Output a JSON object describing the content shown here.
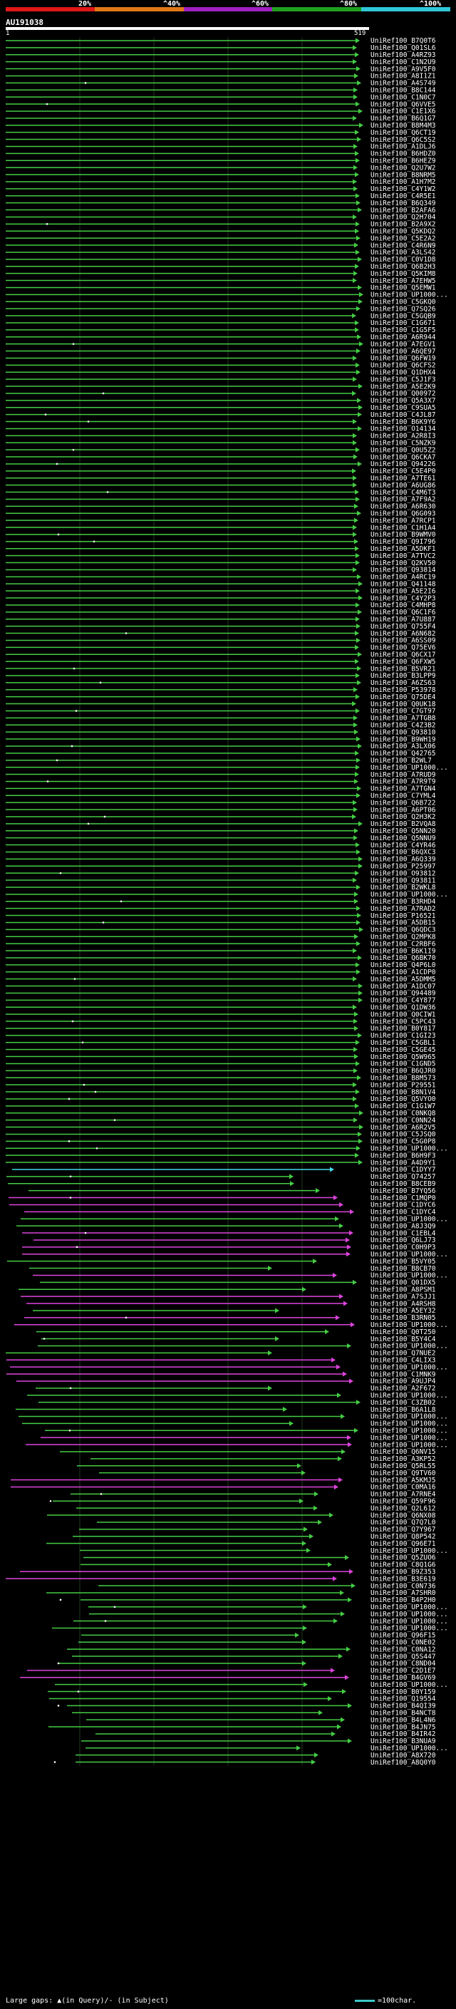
{
  "header": {
    "percent_labels": [
      "20%",
      "^40%",
      "^60%",
      "^80%",
      "^100%"
    ],
    "segment_colors": [
      "#e01818",
      "#e07818",
      "#a020c0",
      "#20a020",
      "#30c8d8"
    ]
  },
  "query": {
    "title": "AU191038",
    "start": "1",
    "end": "519"
  },
  "colors": {
    "green": "#44cc44",
    "magenta": "#dd44dd",
    "cyan": "#44d8e8",
    "grid": "#1e3a1e"
  },
  "hits": [
    {
      "acc": "UniRef100_B7Q0T6",
      "color": "green"
    },
    {
      "acc": "UniRef100_Q01SL6",
      "color": "green"
    },
    {
      "acc": "UniRef100_A4RZ93",
      "color": "green"
    },
    {
      "acc": "UniRef100_C1N2U9",
      "color": "green"
    },
    {
      "acc": "UniRef100_A9V5F0",
      "color": "green"
    },
    {
      "acc": "UniRef100_A8I1Z1",
      "color": "green"
    },
    {
      "acc": "UniRef100_A4S749",
      "color": "green"
    },
    {
      "acc": "UniRef100_B8C144",
      "color": "green"
    },
    {
      "acc": "UniRef100_C1N0C7",
      "color": "green"
    },
    {
      "acc": "UniRef100_Q6VVE5",
      "color": "green"
    },
    {
      "acc": "UniRef100_C1E1X6",
      "color": "green"
    },
    {
      "acc": "UniRef100_B6Q1G7",
      "color": "green"
    },
    {
      "acc": "UniRef100_B8M4M3",
      "color": "green"
    },
    {
      "acc": "UniRef100_Q6CT19",
      "color": "green"
    },
    {
      "acc": "UniRef100_Q6C5S2",
      "color": "green"
    },
    {
      "acc": "UniRef100_A1DLJ6",
      "color": "green"
    },
    {
      "acc": "UniRef100_B6HDZ0",
      "color": "green"
    },
    {
      "acc": "UniRef100_B6HEZ9",
      "color": "green"
    },
    {
      "acc": "UniRef100_Q2U7W2",
      "color": "green"
    },
    {
      "acc": "UniRef100_B8NRM5",
      "color": "green"
    },
    {
      "acc": "UniRef100_A1H7M2",
      "color": "green"
    },
    {
      "acc": "UniRef100_C4Y1W2",
      "color": "green"
    },
    {
      "acc": "UniRef100_C4R5E1",
      "color": "green"
    },
    {
      "acc": "UniRef100_B6Q349",
      "color": "green"
    },
    {
      "acc": "UniRef100_B2AFA6",
      "color": "green"
    },
    {
      "acc": "UniRef100_Q2H704",
      "color": "green"
    },
    {
      "acc": "UniRef100_B2A9X2",
      "color": "green"
    },
    {
      "acc": "UniRef100_Q5KDQ2",
      "color": "green"
    },
    {
      "acc": "UniRef100_C5E2A2",
      "color": "green"
    },
    {
      "acc": "UniRef100_C4R6N9",
      "color": "green"
    },
    {
      "acc": "UniRef100_A3LS42",
      "color": "green"
    },
    {
      "acc": "UniRef100_C0V1D8",
      "color": "green"
    },
    {
      "acc": "UniRef100_Q6B2H3",
      "color": "green"
    },
    {
      "acc": "UniRef100_Q5KIM8",
      "color": "green"
    },
    {
      "acc": "UniRef100_A7EHW5",
      "color": "green"
    },
    {
      "acc": "UniRef100_Q5EMW1",
      "color": "green"
    },
    {
      "acc": "UniRef100_UP1000...",
      "color": "green"
    },
    {
      "acc": "UniRef100_C5GKQ0",
      "color": "green"
    },
    {
      "acc": "UniRef100_Q7SQ26",
      "color": "green"
    },
    {
      "acc": "UniRef100_C5GQB9",
      "color": "green"
    },
    {
      "acc": "UniRef100_C1G671",
      "color": "green"
    },
    {
      "acc": "UniRef100_C1G5F5",
      "color": "green"
    },
    {
      "acc": "UniRef100_A6R944",
      "color": "green"
    },
    {
      "acc": "UniRef100_A7EGV1",
      "color": "green"
    },
    {
      "acc": "UniRef100_A6QE97",
      "color": "green"
    },
    {
      "acc": "UniRef100_Q6FW19",
      "color": "green"
    },
    {
      "acc": "UniRef100_Q6CFS2",
      "color": "green"
    },
    {
      "acc": "UniRef100_Q1DHX4",
      "color": "green"
    },
    {
      "acc": "UniRef100_C5J1F3",
      "color": "green"
    },
    {
      "acc": "UniRef100_A5E2K9",
      "color": "green"
    },
    {
      "acc": "UniRef100_Q00972",
      "color": "green"
    },
    {
      "acc": "UniRef100_Q5A3X7",
      "color": "green"
    },
    {
      "acc": "UniRef100_C9SUA5",
      "color": "green"
    },
    {
      "acc": "UniRef100_C4JL87",
      "color": "green"
    },
    {
      "acc": "UniRef100_B6K9Y6",
      "color": "green"
    },
    {
      "acc": "UniRef100_O14134",
      "color": "green"
    },
    {
      "acc": "UniRef100_A2R8I3",
      "color": "green"
    },
    {
      "acc": "UniRef100_C5NZK9",
      "color": "green"
    },
    {
      "acc": "UniRef100_Q0U5Z2",
      "color": "green"
    },
    {
      "acc": "UniRef100_Q6CKA7",
      "color": "green"
    },
    {
      "acc": "UniRef100_Q94226",
      "color": "green"
    },
    {
      "acc": "UniRef100_C5E4P0",
      "color": "green"
    },
    {
      "acc": "UniRef100_A7TE61",
      "color": "green"
    },
    {
      "acc": "UniRef100_A6UG86",
      "color": "green"
    },
    {
      "acc": "UniRef100_C4M6T3",
      "color": "green"
    },
    {
      "acc": "UniRef100_A7F9A2",
      "color": "green"
    },
    {
      "acc": "UniRef100_A6R630",
      "color": "green"
    },
    {
      "acc": "UniRef100_Q6G093",
      "color": "green"
    },
    {
      "acc": "UniRef100_A7RCP1",
      "color": "green"
    },
    {
      "acc": "UniRef100_C1H1A4",
      "color": "green"
    },
    {
      "acc": "UniRef100_B9WMV0",
      "color": "green"
    },
    {
      "acc": "UniRef100_Q9I796",
      "color": "green"
    },
    {
      "acc": "UniRef100_A5DKF1",
      "color": "green"
    },
    {
      "acc": "UniRef100_A7TVC2",
      "color": "green"
    },
    {
      "acc": "UniRef100_Q2KV50",
      "color": "green"
    },
    {
      "acc": "UniRef100_Q93814",
      "color": "green"
    },
    {
      "acc": "UniRef100_A4RC19",
      "color": "green"
    },
    {
      "acc": "UniRef100_Q41148",
      "color": "green"
    },
    {
      "acc": "UniRef100_A5E2I6",
      "color": "green"
    },
    {
      "acc": "UniRef100_C4Y2P3",
      "color": "green"
    },
    {
      "acc": "UniRef100_C4MHP8",
      "color": "green"
    },
    {
      "acc": "UniRef100_Q6C1F6",
      "color": "green"
    },
    {
      "acc": "UniRef100_A7U887",
      "color": "green"
    },
    {
      "acc": "UniRef100_Q755F4",
      "color": "green"
    },
    {
      "acc": "UniRef100_A6N682",
      "color": "green"
    },
    {
      "acc": "UniRef100_A6SS09",
      "color": "green"
    },
    {
      "acc": "UniRef100_Q75EV6",
      "color": "green"
    },
    {
      "acc": "UniRef100_Q6CX17",
      "color": "green"
    },
    {
      "acc": "UniRef100_Q6FXW5",
      "color": "green"
    },
    {
      "acc": "UniRef100_B5VR21",
      "color": "green"
    },
    {
      "acc": "UniRef100_B3LPP9",
      "color": "green"
    },
    {
      "acc": "UniRef100_A6ZS63",
      "color": "green"
    },
    {
      "acc": "UniRef100_P53978",
      "color": "green"
    },
    {
      "acc": "UniRef100_Q75DE4",
      "color": "green"
    },
    {
      "acc": "UniRef100_Q0UK18",
      "color": "green"
    },
    {
      "acc": "UniRef100_C7GT97",
      "color": "green"
    },
    {
      "acc": "UniRef100_A7TGB8",
      "color": "green"
    },
    {
      "acc": "UniRef100_C4Z3B2",
      "color": "green"
    },
    {
      "acc": "UniRef100_Q93810",
      "color": "green"
    },
    {
      "acc": "UniRef100_B9WH19",
      "color": "green"
    },
    {
      "acc": "UniRef100_A3LX06",
      "color": "green"
    },
    {
      "acc": "UniRef100_Q42765",
      "color": "green"
    },
    {
      "acc": "UniRef100_B2WL7",
      "color": "green"
    },
    {
      "acc": "UniRef100_UP1000...",
      "color": "green"
    },
    {
      "acc": "UniRef100_A7RUD9",
      "color": "green"
    },
    {
      "acc": "UniRef100_A7R9T9",
      "color": "green"
    },
    {
      "acc": "UniRef100_A7TGN4",
      "color": "green"
    },
    {
      "acc": "UniRef100_C7YML4",
      "color": "green"
    },
    {
      "acc": "UniRef100_Q6B722",
      "color": "green"
    },
    {
      "acc": "UniRef100_A6PT06",
      "color": "green"
    },
    {
      "acc": "UniRef100_Q2H3K2",
      "color": "green"
    },
    {
      "acc": "UniRef100_B2VQA8",
      "color": "green"
    },
    {
      "acc": "UniRef100_Q5NN20",
      "color": "green"
    },
    {
      "acc": "UniRef100_Q5NNU9",
      "color": "green"
    },
    {
      "acc": "UniRef100_C4YR46",
      "color": "green"
    },
    {
      "acc": "UniRef100_B6QXC3",
      "color": "green"
    },
    {
      "acc": "UniRef100_A6Q339",
      "color": "green"
    },
    {
      "acc": "UniRef100_P25997",
      "color": "green"
    },
    {
      "acc": "UniRef100_O93812",
      "color": "green"
    },
    {
      "acc": "UniRef100_Q93811",
      "color": "green"
    },
    {
      "acc": "UniRef100_B2WKL8",
      "color": "green"
    },
    {
      "acc": "UniRef100_UP1000...",
      "color": "green"
    },
    {
      "acc": "UniRef100_B3RHD4",
      "color": "green"
    },
    {
      "acc": "UniRef100_A7RAD2",
      "color": "green"
    },
    {
      "acc": "UniRef100_P16521",
      "color": "green"
    },
    {
      "acc": "UniRef100_A5DB15",
      "color": "green"
    },
    {
      "acc": "UniRef100_Q6QDC3",
      "color": "green"
    },
    {
      "acc": "UniRef100_Q2MPK8",
      "color": "green"
    },
    {
      "acc": "UniRef100_C2RBF6",
      "color": "green"
    },
    {
      "acc": "UniRef100_B6K1I9",
      "color": "green"
    },
    {
      "acc": "UniRef100_Q6BK70",
      "color": "green"
    },
    {
      "acc": "UniRef100_Q4P6L0",
      "color": "green"
    },
    {
      "acc": "UniRef100_A1CDP0",
      "color": "green"
    },
    {
      "acc": "UniRef100_A5DMM5",
      "color": "green"
    },
    {
      "acc": "UniRef100_A1DC07",
      "color": "green"
    },
    {
      "acc": "UniRef100_Q94489",
      "color": "green"
    },
    {
      "acc": "UniRef100_C4Y877",
      "color": "green"
    },
    {
      "acc": "UniRef100_Q1DW36",
      "color": "green"
    },
    {
      "acc": "UniRef100_Q0CIW1",
      "color": "green"
    },
    {
      "acc": "UniRef100_C5PC43",
      "color": "green"
    },
    {
      "acc": "UniRef100_B0Y817",
      "color": "green"
    },
    {
      "acc": "UniRef100_C1GI23",
      "color": "green"
    },
    {
      "acc": "UniRef100_C5GBL1",
      "color": "green"
    },
    {
      "acc": "UniRef100_C5GE45",
      "color": "green"
    },
    {
      "acc": "UniRef100_Q5W965",
      "color": "green"
    },
    {
      "acc": "UniRef100_C1GND5",
      "color": "green"
    },
    {
      "acc": "UniRef100_B6QJR0",
      "color": "green"
    },
    {
      "acc": "UniRef100_B8M573",
      "color": "green"
    },
    {
      "acc": "UniRef100_P29551",
      "color": "green"
    },
    {
      "acc": "UniRef100_B8N1V4",
      "color": "green"
    },
    {
      "acc": "UniRef100_Q5VYO0",
      "color": "green"
    },
    {
      "acc": "UniRef100_C1G1W7",
      "color": "green"
    },
    {
      "acc": "UniRef100_C0NKQ8",
      "color": "green"
    },
    {
      "acc": "UniRef100_C0NN24",
      "color": "green"
    },
    {
      "acc": "UniRef100_A6R2V5",
      "color": "green"
    },
    {
      "acc": "UniRef100_C5JSQ0",
      "color": "green"
    },
    {
      "acc": "UniRef100_C5G0P8",
      "color": "green"
    },
    {
      "acc": "UniRef100_UP1000...",
      "color": "green"
    },
    {
      "acc": "UniRef100_B6H9F3",
      "color": "green"
    },
    {
      "acc": "UniRef100_A4D9Y1",
      "color": "green"
    },
    {
      "acc": "UniRef100_C1DYY7",
      "color": "cyan"
    },
    {
      "acc": "UniRef100_Q74257",
      "color": "green"
    },
    {
      "acc": "UniRef100_B8CEB9",
      "color": "green"
    },
    {
      "acc": "UniRef100_B7YQ56",
      "color": "green"
    },
    {
      "acc": "UniRef100_C1MQP0",
      "color": "magenta"
    },
    {
      "acc": "UniRef100_C1DYC6",
      "color": "magenta"
    },
    {
      "acc": "UniRef100_C1DYC4",
      "color": "magenta"
    },
    {
      "acc": "UniRef100_UP1000...",
      "color": "green"
    },
    {
      "acc": "UniRef100_A8J3Q9",
      "color": "green"
    },
    {
      "acc": "UniRef100_C1EBL4",
      "color": "magenta"
    },
    {
      "acc": "UniRef100_Q6LJ73",
      "color": "magenta"
    },
    {
      "acc": "UniRef100_C0H9P3",
      "color": "magenta"
    },
    {
      "acc": "UniRef100_UP1000...",
      "color": "magenta"
    },
    {
      "acc": "UniRef100_B5VY05",
      "color": "green"
    },
    {
      "acc": "UniRef100_B8CB70",
      "color": "green"
    },
    {
      "acc": "UniRef100_UP1000...",
      "color": "magenta"
    },
    {
      "acc": "UniRef100_Q01DX5",
      "color": "green"
    },
    {
      "acc": "UniRef100_A8PSM1",
      "color": "green"
    },
    {
      "acc": "UniRef100_A7SJJ1",
      "color": "magenta"
    },
    {
      "acc": "UniRef100_A4RSH8",
      "color": "magenta"
    },
    {
      "acc": "UniRef100_A5EY32",
      "color": "green"
    },
    {
      "acc": "UniRef100_B3RN05",
      "color": "magenta"
    },
    {
      "acc": "UniRef100_UP1000...",
      "color": "magenta"
    },
    {
      "acc": "UniRef100_Q0T250",
      "color": "green"
    },
    {
      "acc": "UniRef100_B5Y4C4",
      "color": "green"
    },
    {
      "acc": "UniRef100_UP1000...",
      "color": "green"
    },
    {
      "acc": "UniRef100_Q7NUE2",
      "color": "green"
    },
    {
      "acc": "UniRef100_C4LIX3",
      "color": "magenta"
    },
    {
      "acc": "UniRef100_UP1000...",
      "color": "magenta"
    },
    {
      "acc": "UniRef100_C1MNK9",
      "color": "magenta"
    },
    {
      "acc": "UniRef100_A9UJP4",
      "color": "magenta"
    },
    {
      "acc": "UniRef100_A2F672",
      "color": "green"
    },
    {
      "acc": "UniRef100_UP1000...",
      "color": "green"
    },
    {
      "acc": "UniRef100_C3ZB02",
      "color": "green"
    },
    {
      "acc": "UniRef100_B6A1L8",
      "color": "green"
    },
    {
      "acc": "UniRef100_UP1000...",
      "color": "green"
    },
    {
      "acc": "UniRef100_UP1000...",
      "color": "green"
    },
    {
      "acc": "UniRef100_UP1000...",
      "color": "green"
    },
    {
      "acc": "UniRef100_UP1000...",
      "color": "magenta"
    },
    {
      "acc": "UniRef100_UP1000...",
      "color": "magenta"
    },
    {
      "acc": "UniRef100_Q6NV15",
      "color": "green"
    },
    {
      "acc": "UniRef100_A3KP52",
      "color": "green"
    },
    {
      "acc": "UniRef100_Q5RL55",
      "color": "green"
    },
    {
      "acc": "UniRef100_Q9TV60",
      "color": "green"
    },
    {
      "acc": "UniRef100_A5KMJ5",
      "color": "magenta"
    },
    {
      "acc": "UniRef100_C0MA16",
      "color": "magenta"
    },
    {
      "acc": "UniRef100_A7RNE4",
      "color": "green"
    },
    {
      "acc": "UniRef100_Q59F96",
      "color": "green"
    },
    {
      "acc": "UniRef100_Q2L612",
      "color": "green"
    },
    {
      "acc": "UniRef100_Q6NX08",
      "color": "green"
    },
    {
      "acc": "UniRef100_Q7Q7L0",
      "color": "green"
    },
    {
      "acc": "UniRef100_Q7Y967",
      "color": "green"
    },
    {
      "acc": "UniRef100_Q8P542",
      "color": "green"
    },
    {
      "acc": "UniRef100_Q96E71",
      "color": "green"
    },
    {
      "acc": "UniRef100_UP1000...",
      "color": "green"
    },
    {
      "acc": "UniRef100_Q5ZUO6",
      "color": "green"
    },
    {
      "acc": "UniRef100_C8Q1G6",
      "color": "green"
    },
    {
      "acc": "UniRef100_B9Z353",
      "color": "magenta"
    },
    {
      "acc": "UniRef100_B3E619",
      "color": "magenta"
    },
    {
      "acc": "UniRef100_C0N736",
      "color": "green"
    },
    {
      "acc": "UniRef100_A7SHR0",
      "color": "green"
    },
    {
      "acc": "UniRef100_B4P2H0",
      "color": "green"
    },
    {
      "acc": "UniRef100_UP1000...",
      "color": "green"
    },
    {
      "acc": "UniRef100_UP1000...",
      "color": "green"
    },
    {
      "acc": "UniRef100_UP1000...",
      "color": "green"
    },
    {
      "acc": "UniRef100_UP1000...",
      "color": "green"
    },
    {
      "acc": "UniRef100_Q96F15",
      "color": "green"
    },
    {
      "acc": "UniRef100_C0NE02",
      "color": "green"
    },
    {
      "acc": "UniRef100_C0NA12",
      "color": "green"
    },
    {
      "acc": "UniRef100_Q5S447",
      "color": "green"
    },
    {
      "acc": "UniRef100_C8ND04",
      "color": "green"
    },
    {
      "acc": "UniRef100_C2D1E7",
      "color": "magenta"
    },
    {
      "acc": "UniRef100_B4GV69",
      "color": "magenta"
    },
    {
      "acc": "UniRef100_UP1000...",
      "color": "green"
    },
    {
      "acc": "UniRef100_B0Y159",
      "color": "green"
    },
    {
      "acc": "UniRef100_Q19554",
      "color": "green"
    },
    {
      "acc": "UniRef100_B4QI39",
      "color": "green"
    },
    {
      "acc": "UniRef100_B4NCT8",
      "color": "green"
    },
    {
      "acc": "UniRef100_B4L4N6",
      "color": "green"
    },
    {
      "acc": "UniRef100_B4JN75",
      "color": "green"
    },
    {
      "acc": "UniRef100_B4IR42",
      "color": "green"
    },
    {
      "acc": "UniRef100_B3NUA9",
      "color": "green"
    },
    {
      "acc": "UniRef100_UP1000...",
      "color": "green"
    },
    {
      "acc": "UniRef100_A8X720",
      "color": "green"
    },
    {
      "acc": "UniRef100_A8Q0Y0",
      "color": "green"
    }
  ],
  "footer": {
    "legend": "Large gaps: ▲(in Query)/- (in Subject)",
    "scale": "=100char."
  }
}
